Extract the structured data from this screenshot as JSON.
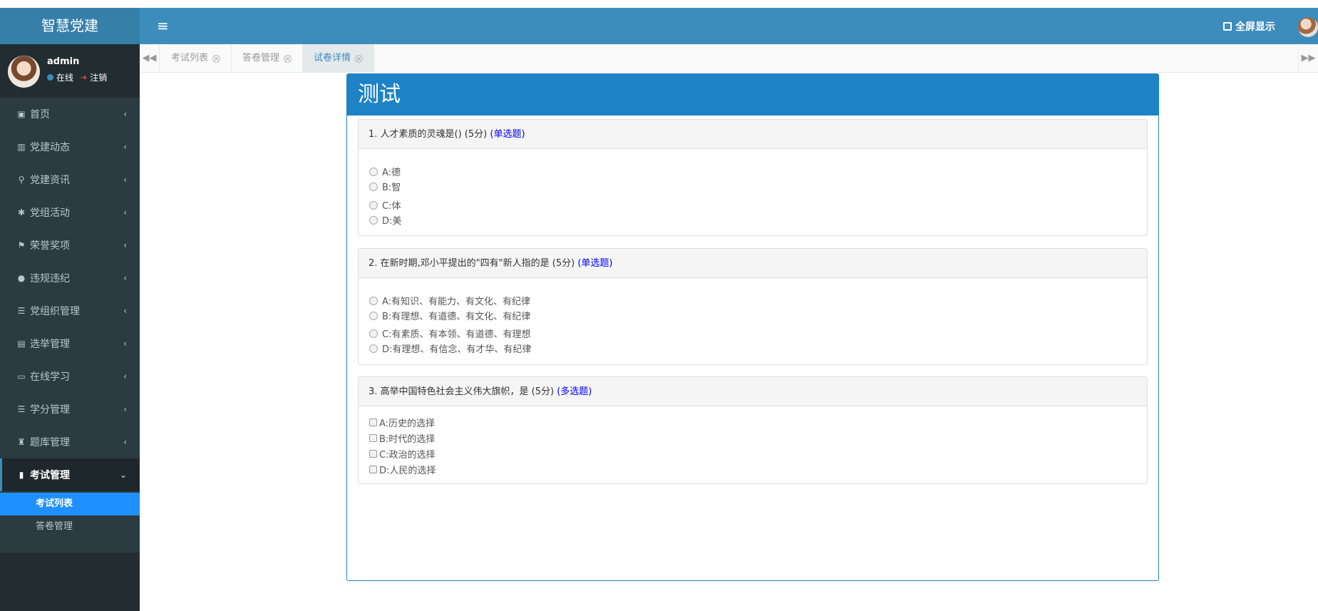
{
  "app": {
    "title": "智慧党建"
  },
  "header": {
    "menu_toggle_glyph": "≡",
    "fullscreen_label": "全屏显示"
  },
  "user": {
    "name": "admin",
    "online_label": "在线",
    "logout_label": "注销"
  },
  "sidebar": {
    "items": [
      {
        "label": "首页",
        "icon": "dashboard-icon",
        "glyph": "▣"
      },
      {
        "label": "党建动态",
        "icon": "bar-chart-icon",
        "glyph": "▥"
      },
      {
        "label": "党建资讯",
        "icon": "binoculars-icon",
        "glyph": "⚲"
      },
      {
        "label": "党组活动",
        "icon": "asterisk-icon",
        "glyph": "✱"
      },
      {
        "label": "荣誉奖项",
        "icon": "trophy-icon",
        "glyph": "⚑"
      },
      {
        "label": "违规违纪",
        "icon": "globe-icon",
        "glyph": "●"
      },
      {
        "label": "党组织管理",
        "icon": "list-icon",
        "glyph": "☰"
      },
      {
        "label": "选举管理",
        "icon": "book-icon",
        "glyph": "▤"
      },
      {
        "label": "在线学习",
        "icon": "credit-card-icon",
        "glyph": "▭"
      },
      {
        "label": "学分管理",
        "icon": "list-icon",
        "glyph": "☰"
      },
      {
        "label": "题库管理",
        "icon": "sitemap-icon",
        "glyph": "♜"
      }
    ],
    "active_item": {
      "label": "考试管理",
      "icon": "bookmark-icon",
      "glyph": "▮"
    },
    "sub_items": [
      {
        "label": "考试列表"
      },
      {
        "label": "答卷管理"
      }
    ]
  },
  "tabs": [
    {
      "label": "考试列表"
    },
    {
      "label": "答卷管理"
    },
    {
      "label": "试卷详情"
    }
  ],
  "exam": {
    "title": "测试",
    "questions": [
      {
        "text": "1. 人才素质的灵魂是() (5分)",
        "type": "(单选题)",
        "options": [
          "A:德",
          "B:智",
          "C:体",
          "D:美"
        ]
      },
      {
        "text": "2. 在新时期,邓小平提出的\"四有\"新人指的是 (5分)",
        "type": "(单选题)",
        "options": [
          "A:有知识、有能力、有文化、有纪律",
          "B:有理想、有道德、有文化、有纪律",
          "C:有素质、有本领、有道德、有理想",
          "D:有理想、有信念、有才华、有纪律"
        ]
      },
      {
        "text": "3. 高举中国特色社会主义伟大旗帜，是 (5分)",
        "type": "(多选题)",
        "options": [
          "A:历史的选择",
          "B:时代的选择",
          "C:政治的选择",
          "D:人民的选择"
        ]
      }
    ]
  },
  "colors": {
    "header": "#3c8dbc",
    "logo": "#367fa9",
    "sidebar": "#222d32",
    "exam_header": "#1e82c6",
    "active_sub": "#1e90ff"
  }
}
